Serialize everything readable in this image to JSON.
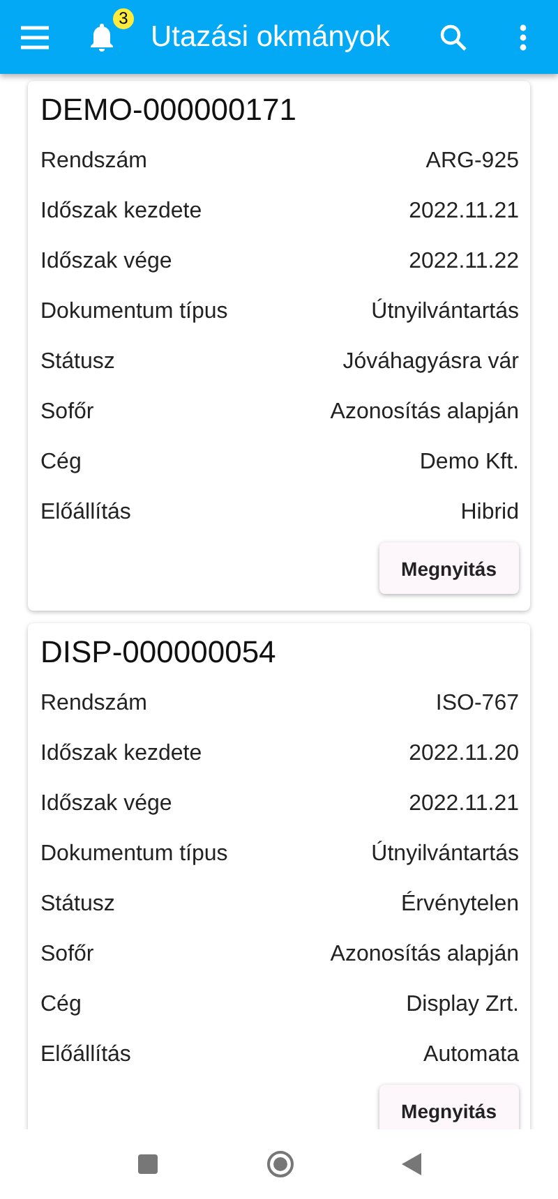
{
  "app_bar": {
    "title": "Utazási okmányok",
    "notification_count": "3"
  },
  "documents": [
    {
      "title": "DEMO-000000171",
      "fields": [
        {
          "label": "Rendszám",
          "value": "ARG-925"
        },
        {
          "label": "Időszak kezdete",
          "value": "2022.11.21"
        },
        {
          "label": "Időszak vége",
          "value": "2022.11.22"
        },
        {
          "label": "Dokumentum típus",
          "value": "Útnyilvántartás"
        },
        {
          "label": "Státusz",
          "value": "Jóváhagyásra vár"
        },
        {
          "label": "Sofőr",
          "value": "Azonosítás alapján"
        },
        {
          "label": "Cég",
          "value": "Demo Kft."
        },
        {
          "label": "Előállítás",
          "value": "Hibrid"
        }
      ],
      "button": "Megnyitás"
    },
    {
      "title": "DISP-000000054",
      "fields": [
        {
          "label": "Rendszám",
          "value": "ISO-767"
        },
        {
          "label": "Időszak kezdete",
          "value": "2022.11.20"
        },
        {
          "label": "Időszak vége",
          "value": "2022.11.21"
        },
        {
          "label": "Dokumentum típus",
          "value": "Útnyilvántartás"
        },
        {
          "label": "Státusz",
          "value": "Érvénytelen"
        },
        {
          "label": "Sofőr",
          "value": "Azonosítás alapján"
        },
        {
          "label": "Cég",
          "value": "Display Zrt."
        },
        {
          "label": "Előállítás",
          "value": "Automata"
        }
      ],
      "button": "Megnyitás"
    }
  ]
}
